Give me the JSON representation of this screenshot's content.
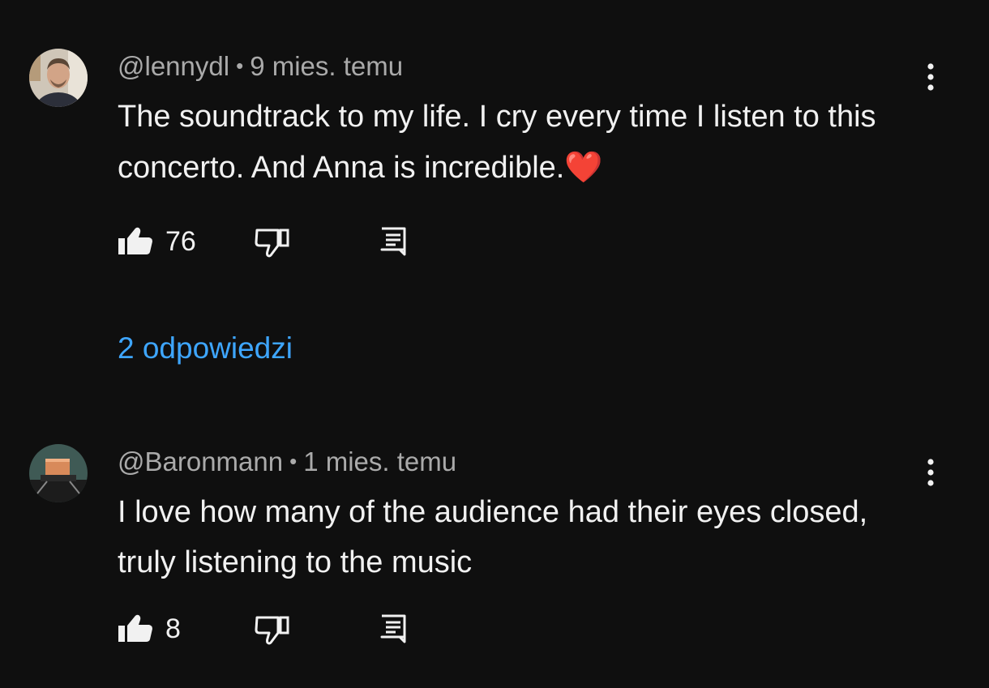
{
  "comments": [
    {
      "author": "@lennydl",
      "separator": "•",
      "time": "9 mies. temu",
      "text": "The soundtrack to my life. I cry every time I listen to this concerto. And Anna is incredible.",
      "emoji": "❤️",
      "likes": "76",
      "replies_label": "2 odpowiedzi"
    },
    {
      "author": "@Baronmann",
      "separator": "•",
      "time": "1 mies. temu",
      "text": "I love how many of the audience had their eyes closed, truly listening to the music",
      "likes": "8"
    }
  ],
  "colors": {
    "background": "#0f0f0f",
    "text": "#f1f1f1",
    "meta": "#aaaaaa",
    "link": "#3ea6ff",
    "heart": "#e8202a"
  },
  "icons": [
    "thumb-up-icon",
    "thumb-down-icon",
    "reply-icon",
    "more-vert-icon"
  ]
}
